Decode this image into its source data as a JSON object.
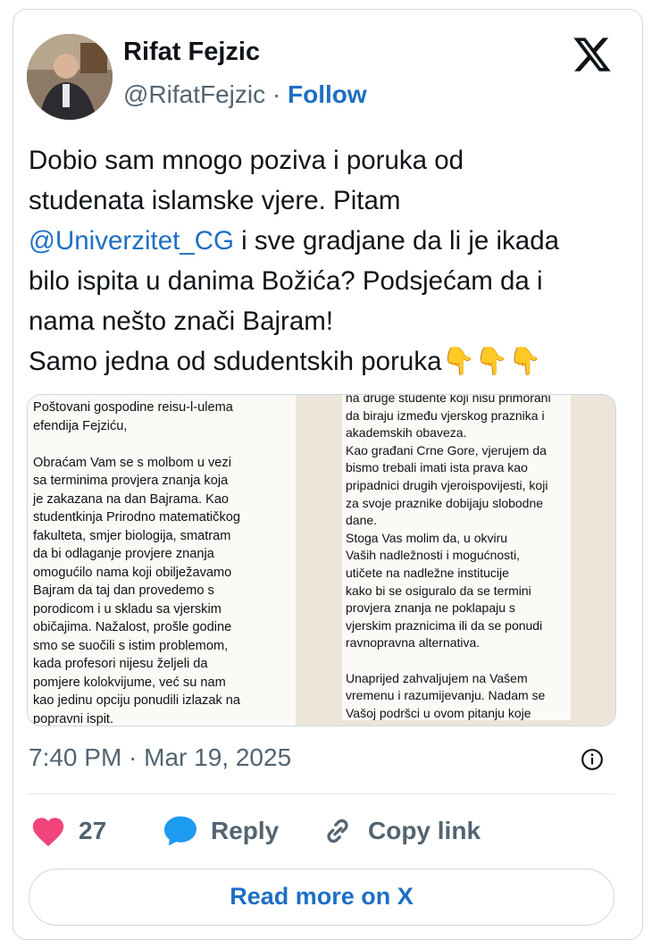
{
  "author": {
    "name": "Rifat Fejzic",
    "handle": "@RifatFejzic",
    "separator": "·",
    "follow_label": "Follow"
  },
  "tweet": {
    "line1": "Dobio sam mnogo poziva i poruka od",
    "line2": "studenata islamske vjere. Pitam",
    "mention": "@Univerzitet_CG",
    "line3_rest": " i sve gradjane da li je ikada",
    "line4": "bilo ispita u danima Božića? Podsjećam da i",
    "line5": "nama nešto znači Bajram!",
    "line6": "Samo jedna od sdudentskih poruka",
    "emojis": "👇👇👇"
  },
  "media": {
    "left_text": "Poštovani gospodine reisu-l-ulema\nefendija Fejziću,\n\nObraćam Vam se s molbom u vezi\nsa terminima provjera znanja koja\nje zakazana na dan Bajrama. Kao\nstudentkinja Prirodno matematičkog\nfakulteta, smjer biologija, smatram\nda bi odlaganje provjere znanja\nomogućilo nama koji obilježavamo\nBajram da taj dan provedemo s\nporodicom i u skladu sa vjerskim\nobičajima. Nažalost, prošle godine\nsmo se suočili s istim problemom,\nkada profesori nijesu željeli da\npomjere kolokvijume, već su nam\nkao jedinu opciju ponudili izlazak na\npopravni ispit.",
    "right_text": "na druge studente koji nisu primorani\nda biraju između vjerskog praznika i\nakademskih obaveza.\nKao građani Crne Gore, vjerujem da\nbismo trebali imati ista prava kao\npripadnici drugih vjeroispovijesti, koji\nza svoje praznike dobijaju slobodne\ndane.\nStoga Vas molim da, u okviru\nVaših nadležnosti i mogućnosti,\nutičete na nadležne institucije\nkako bi se osiguralo da se termini\nprovjera znanja ne poklapaju s\nvjerskim praznicima ili da se ponudi\nravnopravna alternativa.\n\nUnaprijed zahvaljujem na Vašem\nvremenu i razumijevanju. Nadam se\nVašoj podršci u ovom pitanju koje\nse tiče jednakosti i poštovanja prava\nsvih građana."
  },
  "timestamp": "7:40 PM · Mar 19, 2025",
  "actions": {
    "like_count": "27",
    "reply_label": "Reply",
    "copy_label": "Copy link"
  },
  "read_more_label": "Read more on X",
  "icons": {
    "brand": "x-logo-icon",
    "info": "info-icon",
    "like": "heart-icon",
    "reply": "speech-bubble-icon",
    "copy": "link-icon"
  },
  "colors": {
    "link": "#1d6fc4",
    "heart": "#f0447a",
    "reply_bubble": "#1d9bf0",
    "muted": "#536471"
  }
}
